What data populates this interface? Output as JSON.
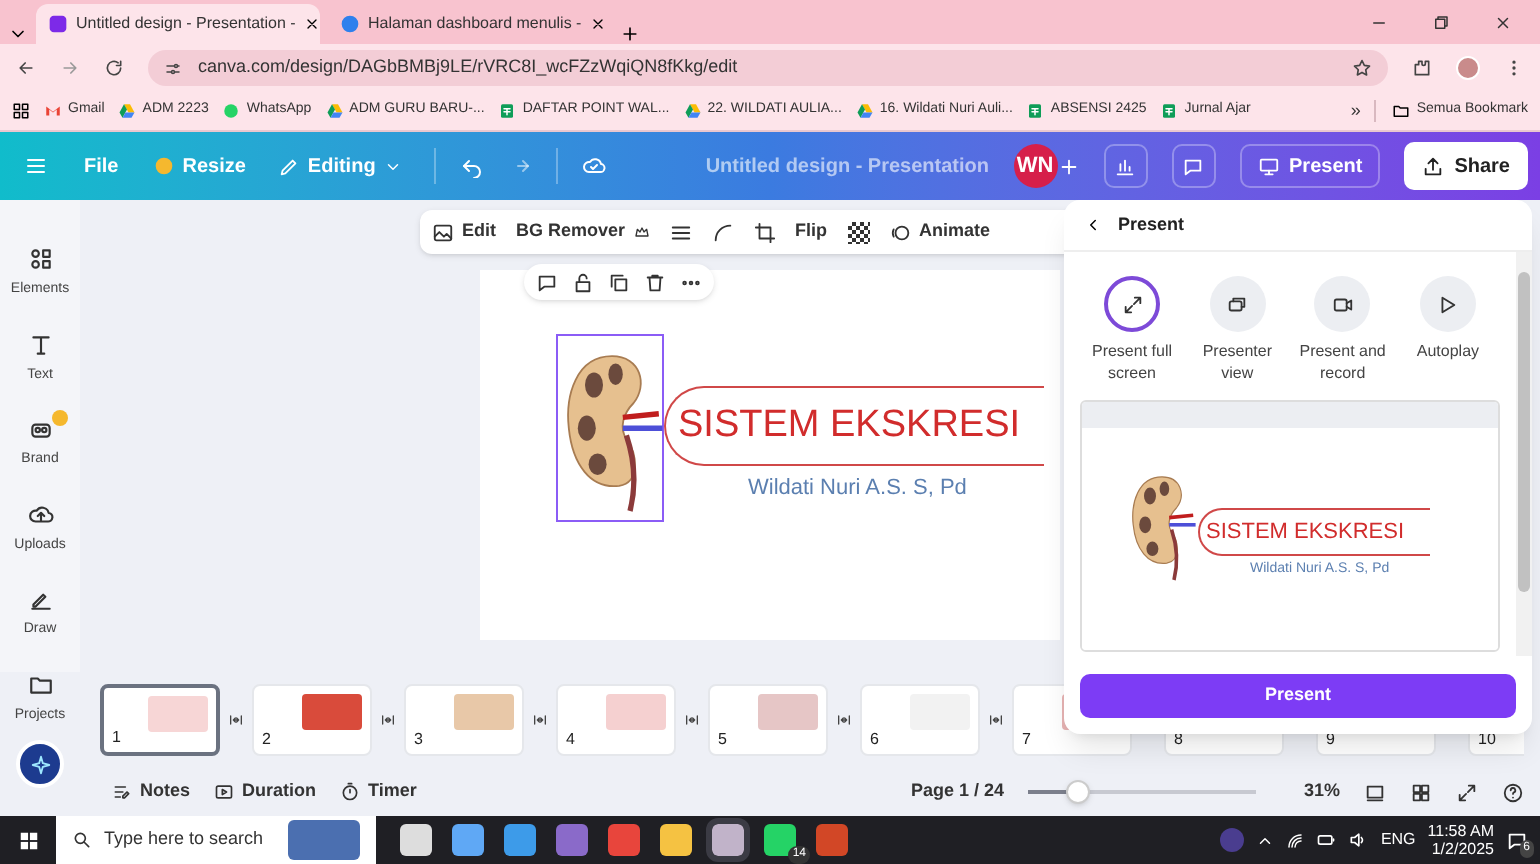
{
  "browser": {
    "tabs": [
      {
        "title": "Untitled design - Presentation -",
        "selected": true
      },
      {
        "title": "Halaman dashboard menulis -",
        "selected": false
      }
    ],
    "url": "canva.com/design/DAGbBMBj9LE/rVRC8I_wcFZzWqiQN8fKkg/edit",
    "bookmarks": [
      {
        "label": "Gmail",
        "kind": "gmail"
      },
      {
        "label": "ADM 2223",
        "kind": "drive"
      },
      {
        "label": "WhatsApp",
        "kind": "whatsapp"
      },
      {
        "label": "ADM GURU BARU-...",
        "kind": "drive"
      },
      {
        "label": "DAFTAR POINT WAL...",
        "kind": "sheet"
      },
      {
        "label": "22. WILDATI AULIA...",
        "kind": "drive"
      },
      {
        "label": "16. Wildati Nuri Auli...",
        "kind": "drive"
      },
      {
        "label": "ABSENSI 2425",
        "kind": "sheet"
      },
      {
        "label": "Jurnal Ajar",
        "kind": "sheet"
      }
    ],
    "more": "»",
    "all_bookmarks": "Semua Bookmark"
  },
  "header": {
    "file": "File",
    "resize": "Resize",
    "editing": "Editing",
    "title": "Untitled design - Presentation",
    "avatar": "WN",
    "present": "Present",
    "share": "Share"
  },
  "sidebar": {
    "items": [
      {
        "label": "Elements",
        "kind": "elements"
      },
      {
        "label": "Text",
        "kind": "text"
      },
      {
        "label": "Brand",
        "kind": "brand"
      },
      {
        "label": "Uploads",
        "kind": "uploads"
      },
      {
        "label": "Draw",
        "kind": "draw"
      },
      {
        "label": "Projects",
        "kind": "projects"
      }
    ]
  },
  "toolbar": {
    "edit": "Edit",
    "bg_remover": "BG Remover",
    "flip": "Flip",
    "animate": "Animate"
  },
  "slide": {
    "title": "SISTEM EKSKRESI",
    "subtitle": "Wildati Nuri A.S. S, Pd"
  },
  "present_panel": {
    "title": "Present",
    "options": [
      {
        "label": "Present full screen",
        "kind": "fullscreen",
        "selected": true
      },
      {
        "label": "Presenter view",
        "kind": "presenter",
        "selected": false
      },
      {
        "label": "Present and record",
        "kind": "record",
        "selected": false
      },
      {
        "label": "Autoplay",
        "kind": "autoplay",
        "selected": false
      }
    ],
    "preview": {
      "title": "SISTEM EKSKRESI",
      "subtitle": "Wildati Nuri A.S. S, Pd"
    },
    "button": "Present"
  },
  "pages": [
    {
      "number": "1",
      "selected": true
    },
    {
      "number": "2",
      "selected": false
    },
    {
      "number": "3",
      "selected": false
    },
    {
      "number": "4",
      "selected": false
    },
    {
      "number": "5",
      "selected": false
    },
    {
      "number": "6",
      "selected": false
    },
    {
      "number": "7",
      "selected": false
    },
    {
      "number": "8",
      "selected": false
    },
    {
      "number": "9",
      "selected": false
    },
    {
      "number": "10",
      "selected": false
    }
  ],
  "footer": {
    "notes": "Notes",
    "duration": "Duration",
    "timer": "Timer",
    "page": "Page 1 / 24",
    "zoom": {
      "level": 0.22
    },
    "zoom_reading": "31%"
  },
  "taskbar": {
    "search_placeholder": "Type here to search",
    "whatsapp_badge": "14",
    "language": "ENG",
    "time": "11:58 AM",
    "date": "1/2/2025",
    "notifications": "6"
  }
}
